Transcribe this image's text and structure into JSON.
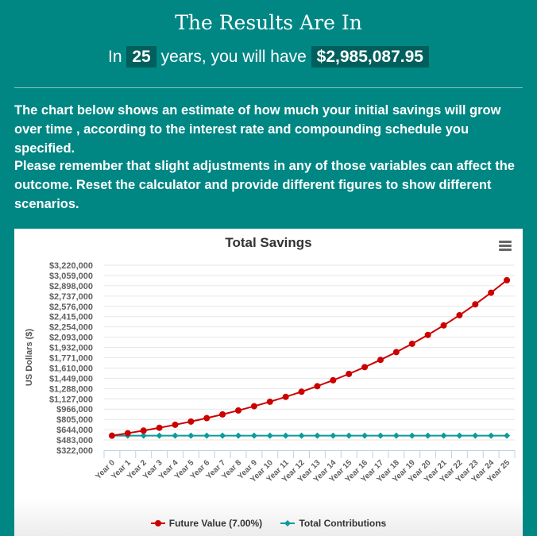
{
  "header": {
    "title": "The Results Are In",
    "subtitle_prefix": "In",
    "years": "25",
    "subtitle_middle": "years, you will have",
    "amount": "$2,985,087.95"
  },
  "paragraphs": [
    "The chart below shows an estimate of how much your initial savings will grow over time , according to the interest rate and compounding schedule you specified.",
    "Please remember that slight adjustments in any of those variables can affect the outcome. Reset the calculator and provide different figures to show different scenarios."
  ],
  "colors": {
    "background": "#008784",
    "highlight": "#005f5c",
    "future_value": "#cc0000",
    "contributions": "#0e9a98"
  },
  "chart_data": {
    "type": "line",
    "title": "Total Savings",
    "xlabel": "",
    "ylabel": "US Dollars ($)",
    "ylim": [
      322000,
      3220000
    ],
    "yticks": [
      322000,
      483000,
      644000,
      805000,
      966000,
      1127000,
      1288000,
      1449000,
      1610000,
      1771000,
      1932000,
      2093000,
      2254000,
      2415000,
      2576000,
      2737000,
      2898000,
      3059000,
      3220000
    ],
    "ytick_labels": [
      "$322,000",
      "$483,000",
      "$644,000",
      "$805,000",
      "$966,000",
      "$1,127,000",
      "$1,288,000",
      "$1,449,000",
      "$1,610,000",
      "$1,771,000",
      "$1,932,000",
      "$2,093,000",
      "$2,254,000",
      "$2,415,000",
      "$2,576,000",
      "$2,737,000",
      "$2,898,000",
      "$3,059,000",
      "$3,220,000"
    ],
    "categories": [
      "Year 0",
      "Year 1",
      "Year 2",
      "Year 3",
      "Year 4",
      "Year 5",
      "Year 6",
      "Year 7",
      "Year 8",
      "Year 9",
      "Year 10",
      "Year 11",
      "Year 12",
      "Year 13",
      "Year 14",
      "Year 15",
      "Year 16",
      "Year 17",
      "Year 18",
      "Year 19",
      "Year 20",
      "Year 21",
      "Year 22",
      "Year 23",
      "Year 24",
      "Year 25"
    ],
    "series": [
      {
        "name": "Future Value (7.00%)",
        "color": "#cc0000",
        "marker": "circle",
        "values": [
          550000,
          588500,
          629695,
          673774,
          720938,
          771404,
          825402,
          883180,
          945003,
          1011153,
          1081934,
          1157669,
          1238706,
          1325415,
          1418194,
          1517468,
          1623691,
          1737349,
          1858963,
          1989091,
          2128327,
          2277310,
          2436722,
          2607292,
          2789803,
          2985088
        ]
      },
      {
        "name": "Total Contributions",
        "color": "#0e9a98",
        "marker": "diamond",
        "values": [
          550000,
          550000,
          550000,
          550000,
          550000,
          550000,
          550000,
          550000,
          550000,
          550000,
          550000,
          550000,
          550000,
          550000,
          550000,
          550000,
          550000,
          550000,
          550000,
          550000,
          550000,
          550000,
          550000,
          550000,
          550000,
          550000
        ]
      }
    ],
    "grid": true,
    "legend": "bottom-center"
  }
}
